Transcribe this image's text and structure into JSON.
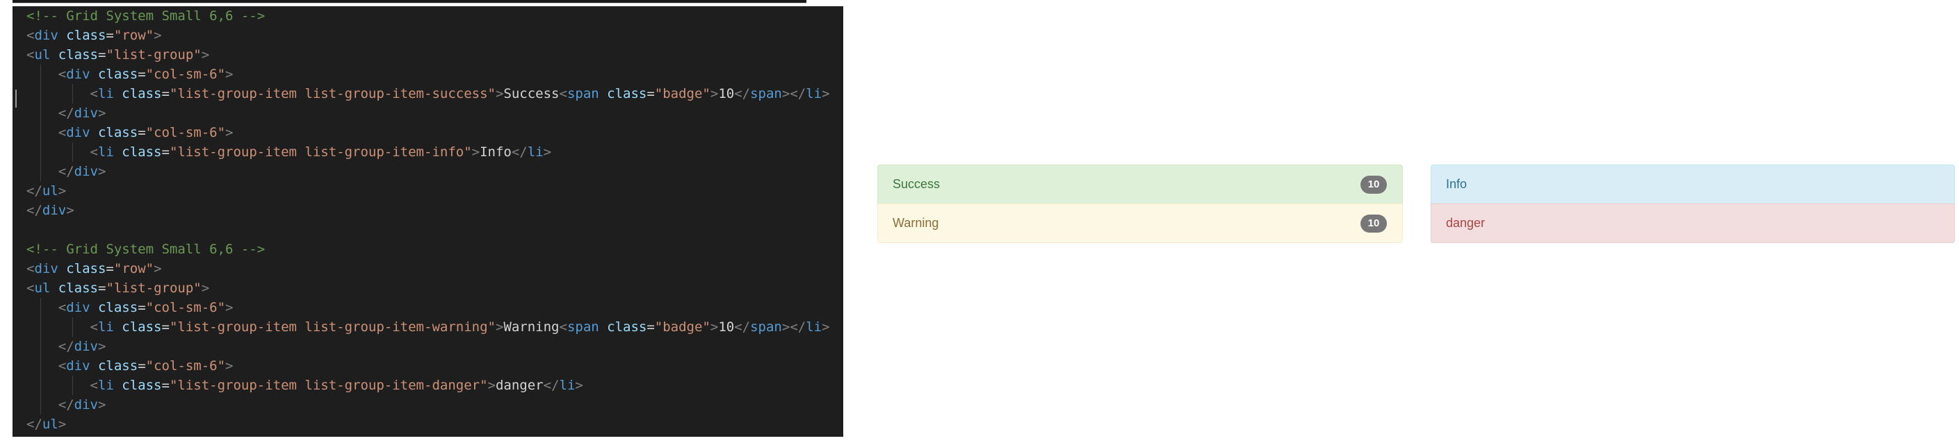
{
  "editor": {
    "lines": [
      [
        {
          "t": "<!-- Grid System Small 6,6 -->",
          "c": "comment"
        }
      ],
      [
        {
          "t": "<",
          "c": "punct"
        },
        {
          "t": "div",
          "c": "tag"
        },
        {
          "t": " class",
          "c": "attr"
        },
        {
          "t": "=",
          "c": "text"
        },
        {
          "t": "\"row\"",
          "c": "str"
        },
        {
          "t": ">",
          "c": "punct"
        }
      ],
      [
        {
          "t": "<",
          "c": "punct"
        },
        {
          "t": "ul",
          "c": "tag"
        },
        {
          "t": " class",
          "c": "attr"
        },
        {
          "t": "=",
          "c": "text"
        },
        {
          "t": "\"list-group\"",
          "c": "str"
        },
        {
          "t": ">",
          "c": "punct"
        }
      ],
      [
        {
          "t": "    ",
          "c": "text"
        },
        {
          "t": "<",
          "c": "punct"
        },
        {
          "t": "div",
          "c": "tag"
        },
        {
          "t": " class",
          "c": "attr"
        },
        {
          "t": "=",
          "c": "text"
        },
        {
          "t": "\"col-sm-6\"",
          "c": "str"
        },
        {
          "t": ">",
          "c": "punct"
        }
      ],
      [
        {
          "t": "        ",
          "c": "text"
        },
        {
          "t": "<",
          "c": "punct"
        },
        {
          "t": "li",
          "c": "tag"
        },
        {
          "t": " class",
          "c": "attr"
        },
        {
          "t": "=",
          "c": "text"
        },
        {
          "t": "\"list-group-item list-group-item-success\"",
          "c": "str"
        },
        {
          "t": ">",
          "c": "punct"
        },
        {
          "t": "Success",
          "c": "text"
        },
        {
          "t": "<",
          "c": "punct"
        },
        {
          "t": "span",
          "c": "tag"
        },
        {
          "t": " class",
          "c": "attr"
        },
        {
          "t": "=",
          "c": "text"
        },
        {
          "t": "\"badge\"",
          "c": "str"
        },
        {
          "t": ">",
          "c": "punct"
        },
        {
          "t": "10",
          "c": "text"
        },
        {
          "t": "</",
          "c": "punct"
        },
        {
          "t": "span",
          "c": "tag"
        },
        {
          "t": "></",
          "c": "punct"
        },
        {
          "t": "li",
          "c": "tag"
        },
        {
          "t": ">",
          "c": "punct"
        }
      ],
      [
        {
          "t": "    ",
          "c": "text"
        },
        {
          "t": "</",
          "c": "punct"
        },
        {
          "t": "div",
          "c": "tag"
        },
        {
          "t": ">",
          "c": "punct"
        }
      ],
      [
        {
          "t": "    ",
          "c": "text"
        },
        {
          "t": "<",
          "c": "punct"
        },
        {
          "t": "div",
          "c": "tag"
        },
        {
          "t": " class",
          "c": "attr"
        },
        {
          "t": "=",
          "c": "text"
        },
        {
          "t": "\"col-sm-6\"",
          "c": "str"
        },
        {
          "t": ">",
          "c": "punct"
        }
      ],
      [
        {
          "t": "        ",
          "c": "text"
        },
        {
          "t": "<",
          "c": "punct"
        },
        {
          "t": "li",
          "c": "tag"
        },
        {
          "t": " class",
          "c": "attr"
        },
        {
          "t": "=",
          "c": "text"
        },
        {
          "t": "\"list-group-item list-group-item-info\"",
          "c": "str"
        },
        {
          "t": ">",
          "c": "punct"
        },
        {
          "t": "Info",
          "c": "text"
        },
        {
          "t": "</",
          "c": "punct"
        },
        {
          "t": "li",
          "c": "tag"
        },
        {
          "t": ">",
          "c": "punct"
        }
      ],
      [
        {
          "t": "    ",
          "c": "text"
        },
        {
          "t": "</",
          "c": "punct"
        },
        {
          "t": "div",
          "c": "tag"
        },
        {
          "t": ">",
          "c": "punct"
        }
      ],
      [
        {
          "t": "</",
          "c": "punct"
        },
        {
          "t": "ul",
          "c": "tag"
        },
        {
          "t": ">",
          "c": "punct"
        }
      ],
      [
        {
          "t": "</",
          "c": "punct"
        },
        {
          "t": "div",
          "c": "tag"
        },
        {
          "t": ">",
          "c": "punct"
        }
      ],
      [],
      [
        {
          "t": "<!-- Grid System Small 6,6 -->",
          "c": "comment"
        }
      ],
      [
        {
          "t": "<",
          "c": "punct"
        },
        {
          "t": "div",
          "c": "tag"
        },
        {
          "t": " class",
          "c": "attr"
        },
        {
          "t": "=",
          "c": "text"
        },
        {
          "t": "\"row\"",
          "c": "str"
        },
        {
          "t": ">",
          "c": "punct"
        }
      ],
      [
        {
          "t": "<",
          "c": "punct"
        },
        {
          "t": "ul",
          "c": "tag"
        },
        {
          "t": " class",
          "c": "attr"
        },
        {
          "t": "=",
          "c": "text"
        },
        {
          "t": "\"list-group\"",
          "c": "str"
        },
        {
          "t": ">",
          "c": "punct"
        }
      ],
      [
        {
          "t": "    ",
          "c": "text"
        },
        {
          "t": "<",
          "c": "punct"
        },
        {
          "t": "div",
          "c": "tag"
        },
        {
          "t": " class",
          "c": "attr"
        },
        {
          "t": "=",
          "c": "text"
        },
        {
          "t": "\"col-sm-6\"",
          "c": "str"
        },
        {
          "t": ">",
          "c": "punct"
        }
      ],
      [
        {
          "t": "        ",
          "c": "text"
        },
        {
          "t": "<",
          "c": "punct"
        },
        {
          "t": "li",
          "c": "tag"
        },
        {
          "t": " class",
          "c": "attr"
        },
        {
          "t": "=",
          "c": "text"
        },
        {
          "t": "\"list-group-item list-group-item-warning\"",
          "c": "str"
        },
        {
          "t": ">",
          "c": "punct"
        },
        {
          "t": "Warning",
          "c": "text"
        },
        {
          "t": "<",
          "c": "punct"
        },
        {
          "t": "span",
          "c": "tag"
        },
        {
          "t": " class",
          "c": "attr"
        },
        {
          "t": "=",
          "c": "text"
        },
        {
          "t": "\"badge\"",
          "c": "str"
        },
        {
          "t": ">",
          "c": "punct"
        },
        {
          "t": "10",
          "c": "text"
        },
        {
          "t": "</",
          "c": "punct"
        },
        {
          "t": "span",
          "c": "tag"
        },
        {
          "t": "></",
          "c": "punct"
        },
        {
          "t": "li",
          "c": "tag"
        },
        {
          "t": ">",
          "c": "punct"
        }
      ],
      [
        {
          "t": "    ",
          "c": "text"
        },
        {
          "t": "</",
          "c": "punct"
        },
        {
          "t": "div",
          "c": "tag"
        },
        {
          "t": ">",
          "c": "punct"
        }
      ],
      [
        {
          "t": "    ",
          "c": "text"
        },
        {
          "t": "<",
          "c": "punct"
        },
        {
          "t": "div",
          "c": "tag"
        },
        {
          "t": " class",
          "c": "attr"
        },
        {
          "t": "=",
          "c": "text"
        },
        {
          "t": "\"col-sm-6\"",
          "c": "str"
        },
        {
          "t": ">",
          "c": "punct"
        }
      ],
      [
        {
          "t": "        ",
          "c": "text"
        },
        {
          "t": "<",
          "c": "punct"
        },
        {
          "t": "li",
          "c": "tag"
        },
        {
          "t": " class",
          "c": "attr"
        },
        {
          "t": "=",
          "c": "text"
        },
        {
          "t": "\"list-group-item list-group-item-danger\"",
          "c": "str"
        },
        {
          "t": ">",
          "c": "punct"
        },
        {
          "t": "danger",
          "c": "text"
        },
        {
          "t": "</",
          "c": "punct"
        },
        {
          "t": "li",
          "c": "tag"
        },
        {
          "t": ">",
          "c": "punct"
        }
      ],
      [
        {
          "t": "    ",
          "c": "text"
        },
        {
          "t": "</",
          "c": "punct"
        },
        {
          "t": "div",
          "c": "tag"
        },
        {
          "t": ">",
          "c": "punct"
        }
      ],
      [
        {
          "t": "</",
          "c": "punct"
        },
        {
          "t": "ul",
          "c": "tag"
        },
        {
          "t": ">",
          "c": "punct"
        }
      ]
    ]
  },
  "preview": {
    "items": [
      {
        "label": "Success",
        "badge": "10",
        "bg": "#dff0d8",
        "fg": "#3c763d",
        "border": "#d6e9c6"
      },
      {
        "label": "Info",
        "badge": "",
        "bg": "#d9edf7",
        "fg": "#31708f",
        "border": "#bce8f1"
      },
      {
        "label": "Warning",
        "badge": "10",
        "bg": "#fcf8e3",
        "fg": "#8a6d3b",
        "border": "#faebcc"
      },
      {
        "label": "danger",
        "badge": "",
        "bg": "#f2dede",
        "fg": "#a94442",
        "border": "#ebccd1"
      }
    ]
  }
}
